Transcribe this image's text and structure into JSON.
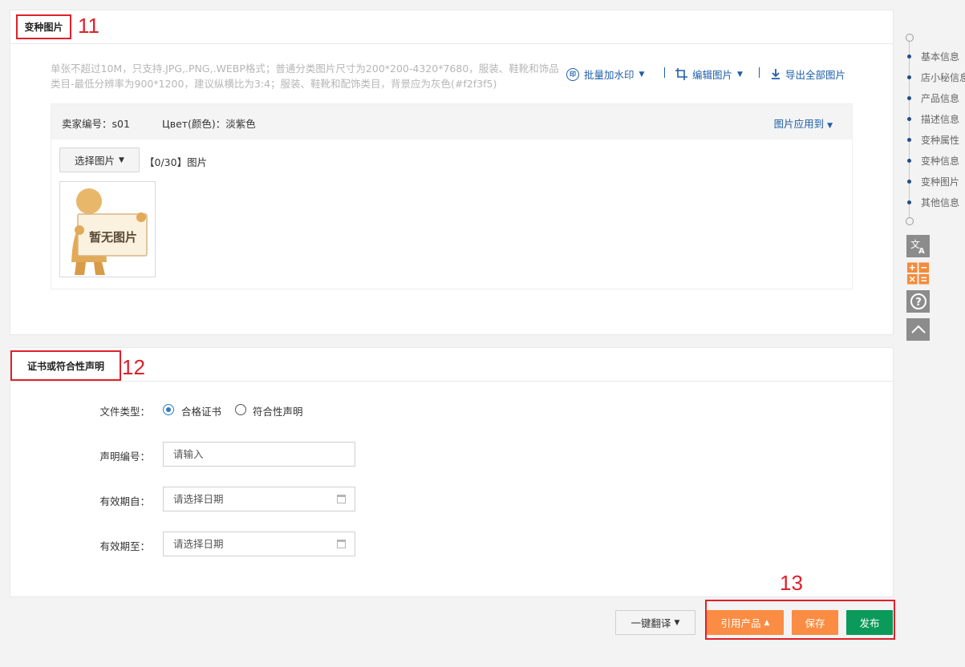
{
  "variant_images": {
    "title": "变种图片",
    "annotation": "11",
    "hint": "单张不超过10M，只支持.JPG,.PNG,.WEBP格式；普通分类图片尺寸为200*200-4320*7680，服装、鞋靴和饰品类目-最低分辨率为900*1200，建议纵横比为3:4；服装、鞋靴和配饰类目，背景应为灰色(#f2f3f5)",
    "tools": {
      "watermark": "批量加水印",
      "edit": "编辑图片",
      "export": "导出全部图片"
    },
    "variant": {
      "seller_code": "卖家编号：s01",
      "color": "Цвет(颜色)：淡紫色",
      "apply_to": "图片应用到",
      "choose_button": "选择图片",
      "count": "【0/30】图片",
      "placeholder_text": "暂无图片"
    }
  },
  "certificate": {
    "title": "证书或符合性声明",
    "annotation": "12",
    "file_type_label": "文件类型：",
    "radio_options": [
      "合格证书",
      "符合性声明"
    ],
    "selected_index": 0,
    "decl_number_label": "声明编号：",
    "decl_number_placeholder": "请输入",
    "valid_from_label": "有效期自：",
    "valid_from_placeholder": "请选择日期",
    "valid_to_label": "有效期至：",
    "valid_to_placeholder": "请选择日期"
  },
  "sidebar": {
    "items": [
      "基本信息",
      "店小秘信息",
      "产品信息",
      "描述信息",
      "变种属性",
      "变种信息",
      "变种图片",
      "其他信息"
    ],
    "tools": [
      "translate-icon",
      "calculator-icon",
      "help-icon",
      "back-to-top-icon"
    ]
  },
  "footer": {
    "annotation": "13",
    "translate": "一键翻译",
    "reference": "引用产品",
    "save": "保存",
    "publish": "发布"
  },
  "colors": {
    "link": "#1f5fa9",
    "orange": "#fa8c43",
    "green": "#0b9a5a",
    "annotation_red": "#e0202a"
  }
}
